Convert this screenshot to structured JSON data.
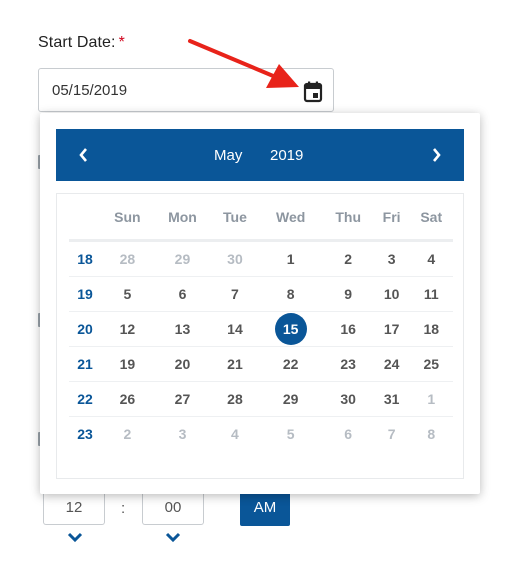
{
  "field": {
    "label": "Start Date:",
    "required_mark": "*",
    "value": "05/15/2019",
    "calendar_icon": "calendar-icon"
  },
  "calendar": {
    "month": "May",
    "year": "2019",
    "prev_icon": "chevron-left-icon",
    "next_icon": "chevron-right-icon",
    "weekdays": [
      "Sun",
      "Mon",
      "Tue",
      "Wed",
      "Thu",
      "Fri",
      "Sat"
    ],
    "weeks": [
      {
        "week": "18",
        "days": [
          "28",
          "29",
          "30",
          "1",
          "2",
          "3",
          "4"
        ]
      },
      {
        "week": "19",
        "days": [
          "5",
          "6",
          "7",
          "8",
          "9",
          "10",
          "11"
        ]
      },
      {
        "week": "20",
        "days": [
          "12",
          "13",
          "14",
          "15",
          "16",
          "17",
          "18"
        ]
      },
      {
        "week": "21",
        "days": [
          "19",
          "20",
          "21",
          "22",
          "23",
          "24",
          "25"
        ]
      },
      {
        "week": "22",
        "days": [
          "26",
          "27",
          "28",
          "29",
          "30",
          "31",
          "1"
        ]
      },
      {
        "week": "23",
        "days": [
          "2",
          "3",
          "4",
          "5",
          "6",
          "7",
          "8"
        ]
      }
    ],
    "selected": "15"
  },
  "time": {
    "hour": "12",
    "separator": ":",
    "minute": "00",
    "period": "AM",
    "down_icon": "chevron-down-icon"
  },
  "colors": {
    "accent": "#0a5698",
    "required": "#d0021b",
    "annotation_arrow": "#e8231a",
    "muted_day": "#b6bcc3"
  }
}
